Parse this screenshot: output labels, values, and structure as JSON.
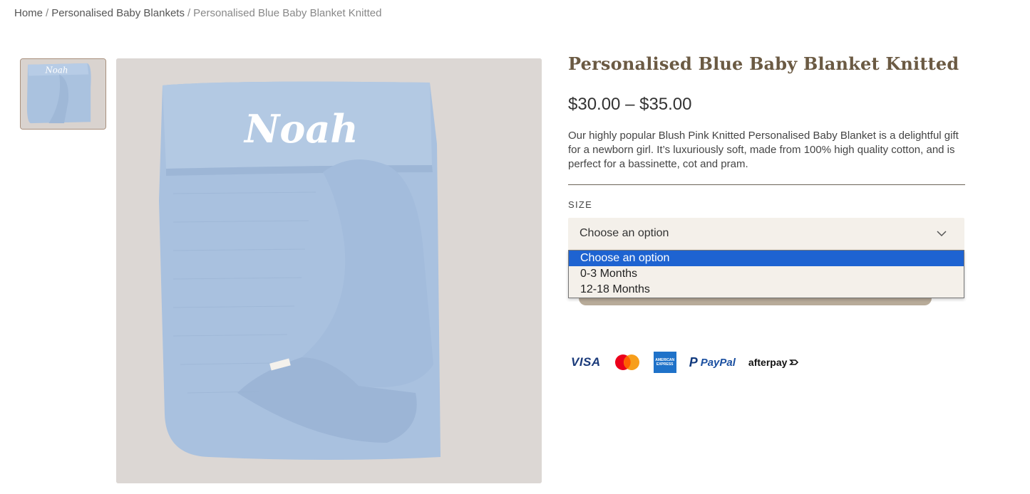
{
  "breadcrumb": {
    "home": "Home",
    "category": "Personalised Baby Blankets",
    "current": "Personalised Blue Baby Blanket Knitted",
    "separator": "/"
  },
  "gallery": {
    "embroidered_name": "Noah"
  },
  "product": {
    "title": "Personalised Blue Baby Blanket Knitted",
    "price": "$30.00 – $35.00",
    "description": "Our highly popular Blush Pink Knitted Personalised Baby Blanket is a delightful gift for a newborn girl. It’s luxuriously soft, made from 100% high quality cotton, and is perfect for a bassinette, cot and pram."
  },
  "size": {
    "label": "SIZE",
    "selected": "Choose an option",
    "options": [
      "Choose an option",
      "0-3 Months",
      "12-18 Months"
    ]
  },
  "payments": {
    "visa": "VISA",
    "mastercard": "mastercard-icon",
    "amex_line1": "AMERICAN",
    "amex_line2": "EXPRESS",
    "paypal": "PayPal",
    "paypal_mark": "P",
    "afterpay": "afterpay"
  },
  "colors": {
    "title": "#6b5a43",
    "select_bg": "#f4f0ea",
    "option_highlight": "#1e63d1",
    "blanket": "#a9c1df"
  }
}
